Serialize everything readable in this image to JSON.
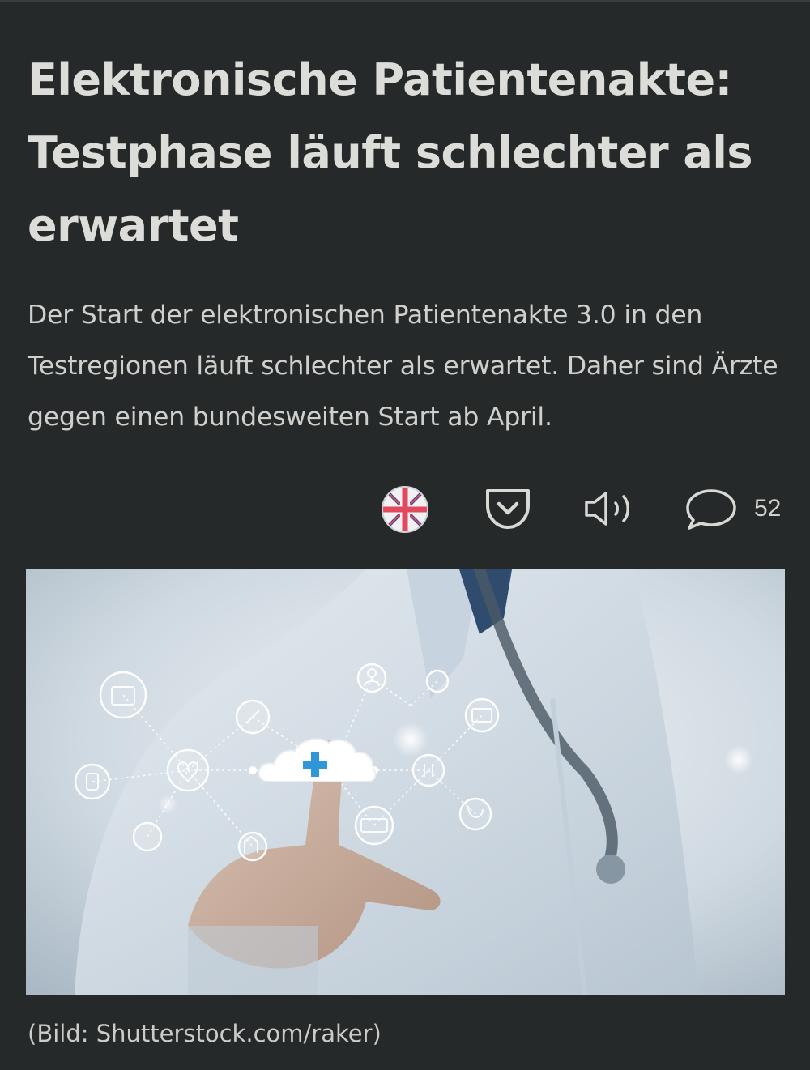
{
  "article": {
    "title": "Elektronische Patientenakte: Testphase läuft schlechter als erwartet",
    "teaser": "Der Start der elektronischen Patientenakte 3.0 in den Testregionen läuft schlechter als erwartet. Daher sind Ärzte gegen einen bundesweiten Start ab April.",
    "image_caption": "(Bild: Shutterstock.com/raker)"
  },
  "actions": {
    "english_version_icon": "union-jack-flag-icon",
    "save_to_pocket_icon": "pocket-icon",
    "read_aloud_icon": "speaker-icon",
    "comments_icon": "speech-bubble-icon",
    "comment_count": "52"
  },
  "colors": {
    "background": "#262929",
    "headline_text": "#dcdcd9",
    "body_text": "#cfcfcc",
    "icon_stroke": "#d8d8d5",
    "cross_accent": "#2f96d8"
  }
}
